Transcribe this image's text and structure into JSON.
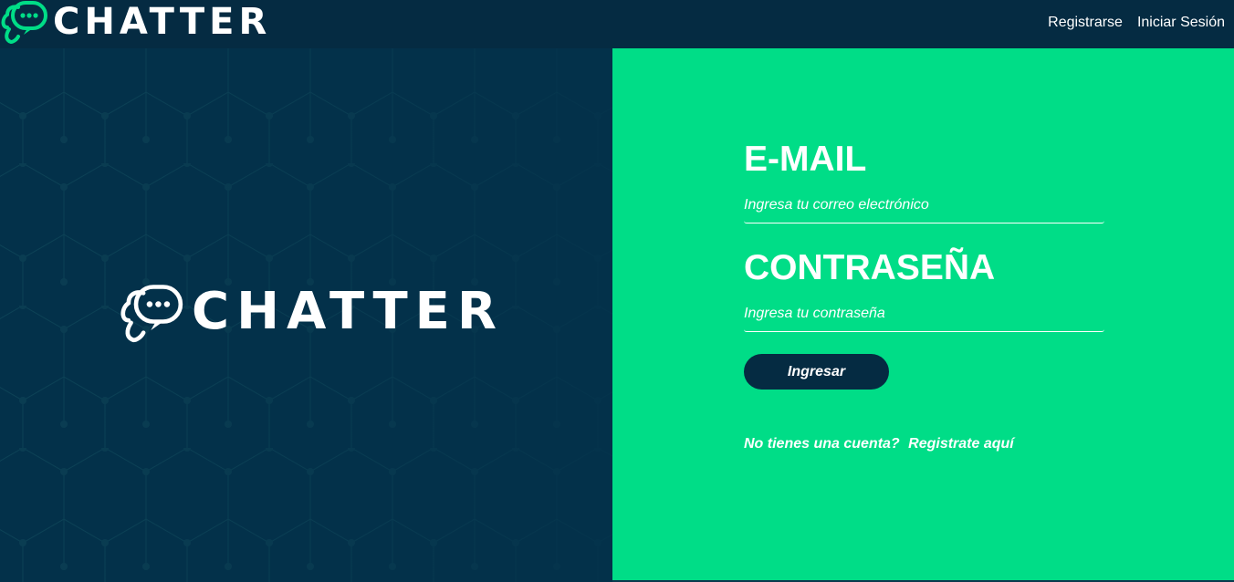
{
  "colors": {
    "navbar_bg": "#052b42",
    "left_panel_bg": "#03314a",
    "accent_green": "#00dd87",
    "text_white": "#ffffff"
  },
  "navbar": {
    "brand": "CHATTER",
    "brand_icon": "chat-bubbles-icon",
    "links": {
      "register": "Registrarse",
      "login": "Iniciar Sesión"
    }
  },
  "hero": {
    "brand": "CHATTER",
    "brand_icon": "chat-bubbles-icon"
  },
  "login_form": {
    "email_label": "E-MAIL",
    "email_placeholder": "Ingresa tu correo electrónico",
    "email_value": "",
    "password_label": "CONTRASEÑA",
    "password_placeholder": "Ingresa tu contraseña",
    "password_value": "",
    "submit_label": "Ingresar",
    "signup_prompt": "No tienes una cuenta?",
    "signup_link": "Registrate aquí"
  }
}
